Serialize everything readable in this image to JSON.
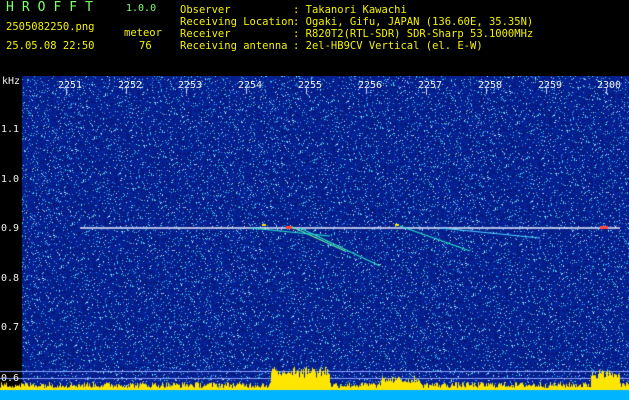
{
  "header": {
    "app_name": "HROFFT",
    "version": "1.0.0",
    "file_name": "2505082250.png",
    "date_time": "25.05.08 22:50",
    "meteor_label": "meteor",
    "meteor_count": "76",
    "info": [
      {
        "label": "Observer",
        "value": ": Takanori Kawachi"
      },
      {
        "label": "Receiving Location",
        "value": ": Ogaki, Gifu, JAPAN (136.60E, 35.35N)"
      },
      {
        "label": "Receiver",
        "value": ": R820T2(RTL-SDR) SDR-Sharp 53.1000MHz"
      },
      {
        "label": "Receiving antenna",
        "value": ": 2el-HB9CV Vertical (el. E-W)"
      }
    ]
  },
  "axes": {
    "y_unit": "kHz",
    "x_ticks": [
      "2251",
      "2252",
      "2253",
      "2254",
      "2255",
      "2256",
      "2257",
      "2258",
      "2259",
      "2300"
    ],
    "y_ticks": [
      "1.1",
      "1.0",
      "0.9",
      "0.8",
      "0.7",
      "0.6"
    ]
  },
  "colors": {
    "background": "#000000",
    "noise_base": "#0a1a8c",
    "carrier_line": "#e8e8ff",
    "echo": "#29e0c8",
    "bottom_bar": "#00b4ff",
    "bottom_peaks": "#ffe600"
  }
}
